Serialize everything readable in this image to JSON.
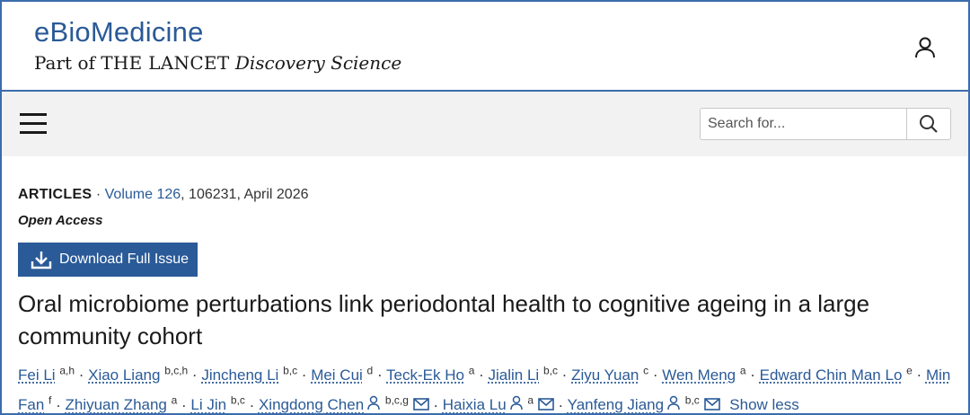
{
  "header": {
    "journal_title": "eBioMedicine",
    "sub_prefix": "Part of ",
    "sub_brand": "THE LANCET",
    "sub_suffix": "Discovery Science"
  },
  "search": {
    "placeholder": "Search for..."
  },
  "article": {
    "type_label": "ARTICLES",
    "separator": "·",
    "volume_link": "Volume 126",
    "citation_rest": ", 106231, April 2026",
    "open_access": "Open Access",
    "download_label": "Download Full Issue",
    "title": "Oral microbiome perturbations link periodontal health to cognitive ageing in a large community cohort"
  },
  "authors": [
    {
      "name": "Fei Li",
      "aff": "a,h"
    },
    {
      "name": "Xiao Liang",
      "aff": "b,c,h"
    },
    {
      "name": "Jincheng Li",
      "aff": "b,c"
    },
    {
      "name": "Mei Cui",
      "aff": "d"
    },
    {
      "name": "Teck-Ek Ho",
      "aff": "a"
    },
    {
      "name": "Jialin Li",
      "aff": "b,c"
    },
    {
      "name": "Ziyu Yuan",
      "aff": "c"
    },
    {
      "name": "Wen Meng",
      "aff": "a"
    },
    {
      "name": "Edward Chin Man Lo",
      "aff": "e"
    },
    {
      "name": "Min Fan",
      "aff": "f"
    },
    {
      "name": "Zhiyuan Zhang",
      "aff": "a"
    },
    {
      "name": "Li Jin",
      "aff": "b,c"
    },
    {
      "name": "Xingdong Chen",
      "aff": "b,c,g",
      "corresponding": true
    },
    {
      "name": "Haixia Lu",
      "aff": "a",
      "corresponding": true
    },
    {
      "name": "Yanfeng Jiang",
      "aff": "b,c",
      "corresponding": true
    }
  ],
  "author_separator": "·",
  "show_less": "Show less",
  "icons": {
    "user": "user-icon",
    "menu": "hamburger-menu-icon",
    "search": "search-icon",
    "download": "download-icon",
    "person": "person-icon",
    "email": "envelope-icon"
  },
  "colors": {
    "brand_blue": "#2a5a97",
    "border_blue": "#3a6cab",
    "toolbar_bg": "#f2f2f2"
  }
}
